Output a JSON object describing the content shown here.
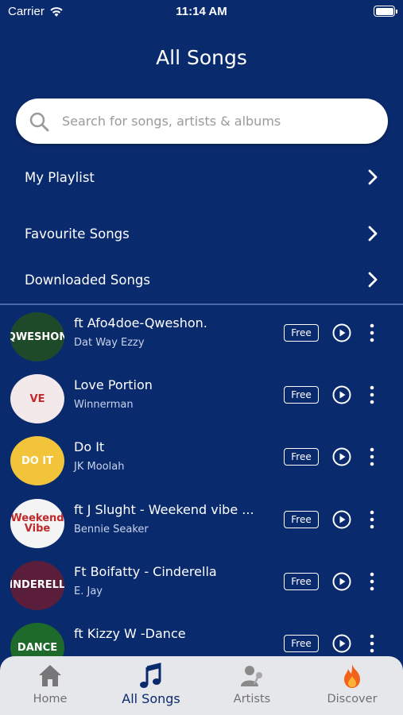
{
  "status": {
    "carrier": "Carrier",
    "time": "11:14 AM"
  },
  "title": "All Songs",
  "search": {
    "placeholder": "Search for songs, artists & albums"
  },
  "menu": [
    {
      "label": "My Playlist"
    },
    {
      "label": "Favourite Songs"
    },
    {
      "label": "Downloaded Songs"
    }
  ],
  "songs": [
    {
      "title": "ft Afo4doe-Qweshon.",
      "artist": "Dat Way Ezzy",
      "badge": "Free",
      "cover_text": "QWESHON",
      "cover_color": "#1f4a2a"
    },
    {
      "title": "Love Portion",
      "artist": "Winnerman",
      "badge": "Free",
      "cover_text": "VE",
      "cover_color": "#f3e8ea"
    },
    {
      "title": "Do It",
      "artist": "JK Moolah",
      "badge": "Free",
      "cover_text": "DO IT",
      "cover_color": "#f2c43a"
    },
    {
      "title": "ft J Slught - Weekend vibe ...",
      "artist": "Bennie Seaker",
      "badge": "Free",
      "cover_text": "Weekend Vibe",
      "cover_color": "#f4f4f4"
    },
    {
      "title": "Ft Boifatty - Cinderella",
      "artist": "E. Jay",
      "badge": "Free",
      "cover_text": "CINDERELLA",
      "cover_color": "#5a1e3a"
    },
    {
      "title": "ft Kizzy W -Dance",
      "artist": "",
      "badge": "Free",
      "cover_text": "DANCE",
      "cover_color": "#1d6a2a"
    }
  ],
  "tabs": [
    {
      "label": "Home",
      "icon": "home-icon"
    },
    {
      "label": "All Songs",
      "icon": "music-note-icon"
    },
    {
      "label": "Artists",
      "icon": "artist-icon"
    },
    {
      "label": "Discover",
      "icon": "fire-icon"
    }
  ],
  "colors": {
    "background": "#0a2a6e",
    "tab_bar": "#e6e7ea",
    "active_tab": "#0a2a6e",
    "fire": "#f2621b"
  }
}
